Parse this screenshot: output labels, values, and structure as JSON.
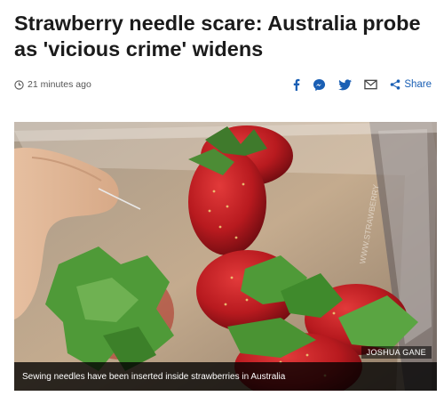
{
  "article": {
    "headline": "Strawberry needle scare: Australia probe as 'vicious crime' widens",
    "timestamp": "21 minutes ago"
  },
  "share": {
    "label": "Share",
    "icons": [
      "facebook-icon",
      "messenger-icon",
      "twitter-icon",
      "email-icon",
      "share-icon"
    ]
  },
  "photo": {
    "credit": "JOSHUA GANE",
    "caption": "Sewing needles have been inserted inside strawberries in Australia"
  },
  "colors": {
    "share_blue": "#1a5fb4",
    "caption_bg": "#000000"
  }
}
